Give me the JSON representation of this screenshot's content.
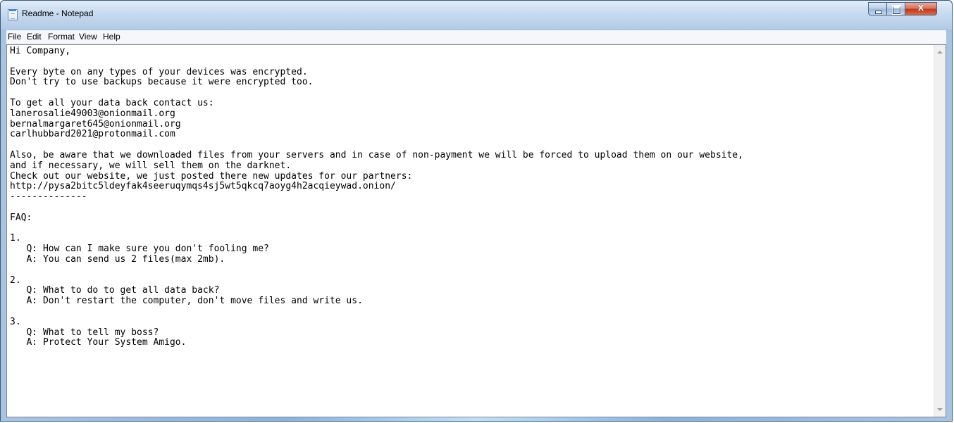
{
  "window": {
    "title": "Readme - Notepad"
  },
  "controls": {
    "close_glyph": "X"
  },
  "menu": {
    "items": [
      "File",
      "Edit",
      "Format",
      "View",
      "Help"
    ]
  },
  "document": {
    "lines": [
      "Hi Company,",
      "",
      "Every byte on any types of your devices was encrypted.",
      "Don't try to use backups because it were encrypted too.",
      "",
      "To get all your data back contact us:",
      "lanerosalie49003@onionmail.org",
      "bernalmargaret645@onionmail.org",
      "carlhubbard2021@protonmail.com",
      "",
      "Also, be aware that we downloaded files from your servers and in case of non-payment we will be forced to upload them on our website,",
      "and if necessary, we will sell them on the darknet.",
      "Check out our website, we just posted there new updates for our partners:",
      "http://pysa2bitc5ldeyfak4seeruqymqs4sj5wt5qkcq7aoyg4h2acqieywad.onion/",
      "--------------",
      "",
      "FAQ:",
      "",
      "1.",
      "   Q: How can I make sure you don't fooling me?",
      "   A: You can send us 2 files(max 2mb).",
      "",
      "2.",
      "   Q: What to do to get all data back?",
      "   A: Don't restart the computer, don't move files and write us.",
      "",
      "3.",
      "   Q: What to tell my boss?",
      "   A: Protect Your System Amigo."
    ]
  }
}
